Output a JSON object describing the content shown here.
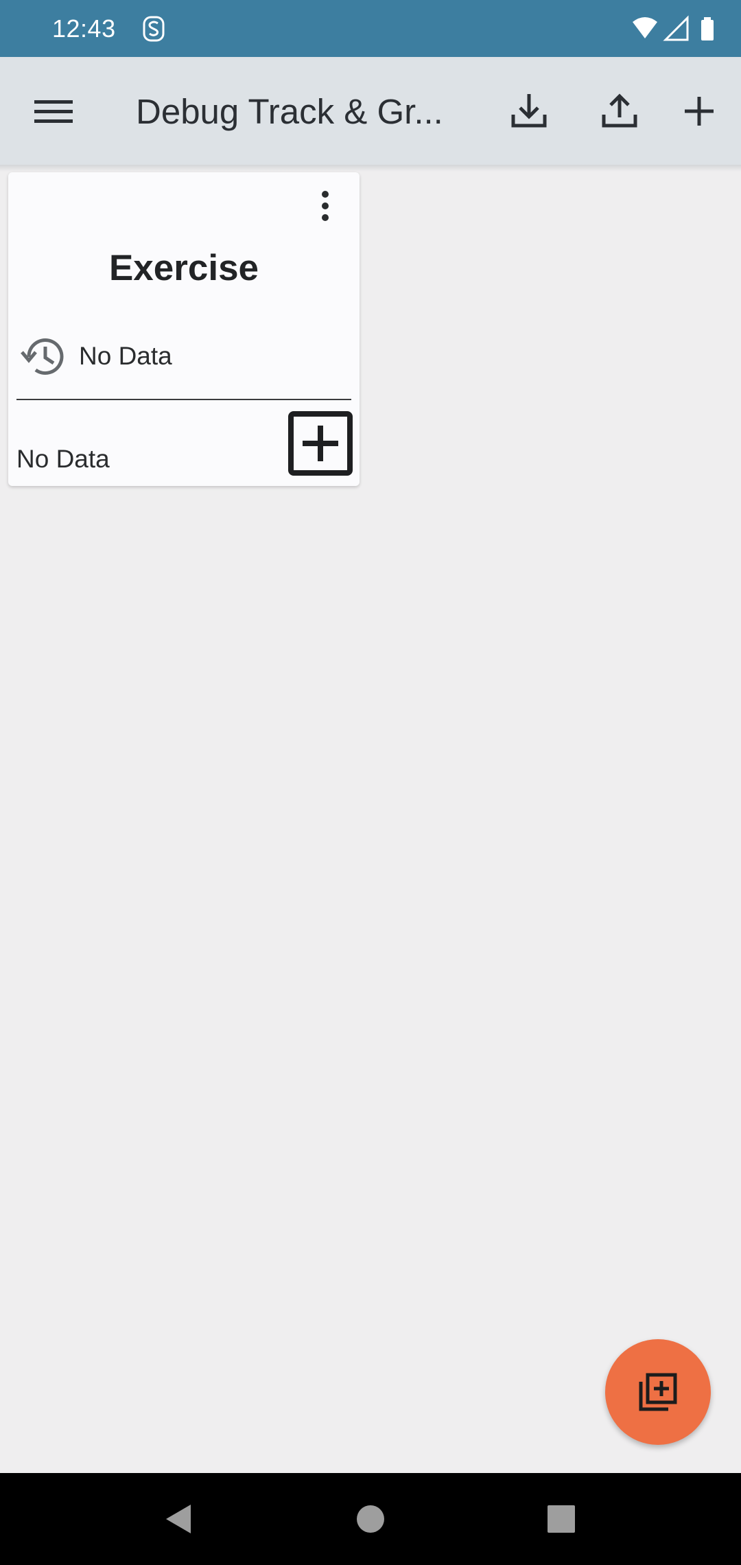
{
  "status_bar": {
    "time": "12:43",
    "icons": [
      "notification-s-icon",
      "wifi-icon",
      "cell-signal-icon",
      "battery-icon"
    ]
  },
  "app_bar": {
    "title": "Debug Track & Gr...",
    "icons": [
      "menu-icon",
      "download-icon",
      "upload-icon",
      "add-icon"
    ]
  },
  "tracker_card": {
    "title": "Exercise",
    "last_tracked": "No Data",
    "value": "No Data",
    "icons": [
      "more-vert-icon",
      "history-icon",
      "add-box-icon"
    ]
  },
  "fab": {
    "icon": "add-to-photos-icon"
  },
  "nav_bar": {
    "icons": [
      "back-triangle-icon",
      "home-circle-icon",
      "recents-square-icon"
    ]
  },
  "colors": {
    "status_bar": "#3d7ea0",
    "app_bar": "#dde2e6",
    "background": "#efeeef",
    "card": "#fbfbfd",
    "fab": "#ee7044",
    "nav_bar": "#000000"
  }
}
